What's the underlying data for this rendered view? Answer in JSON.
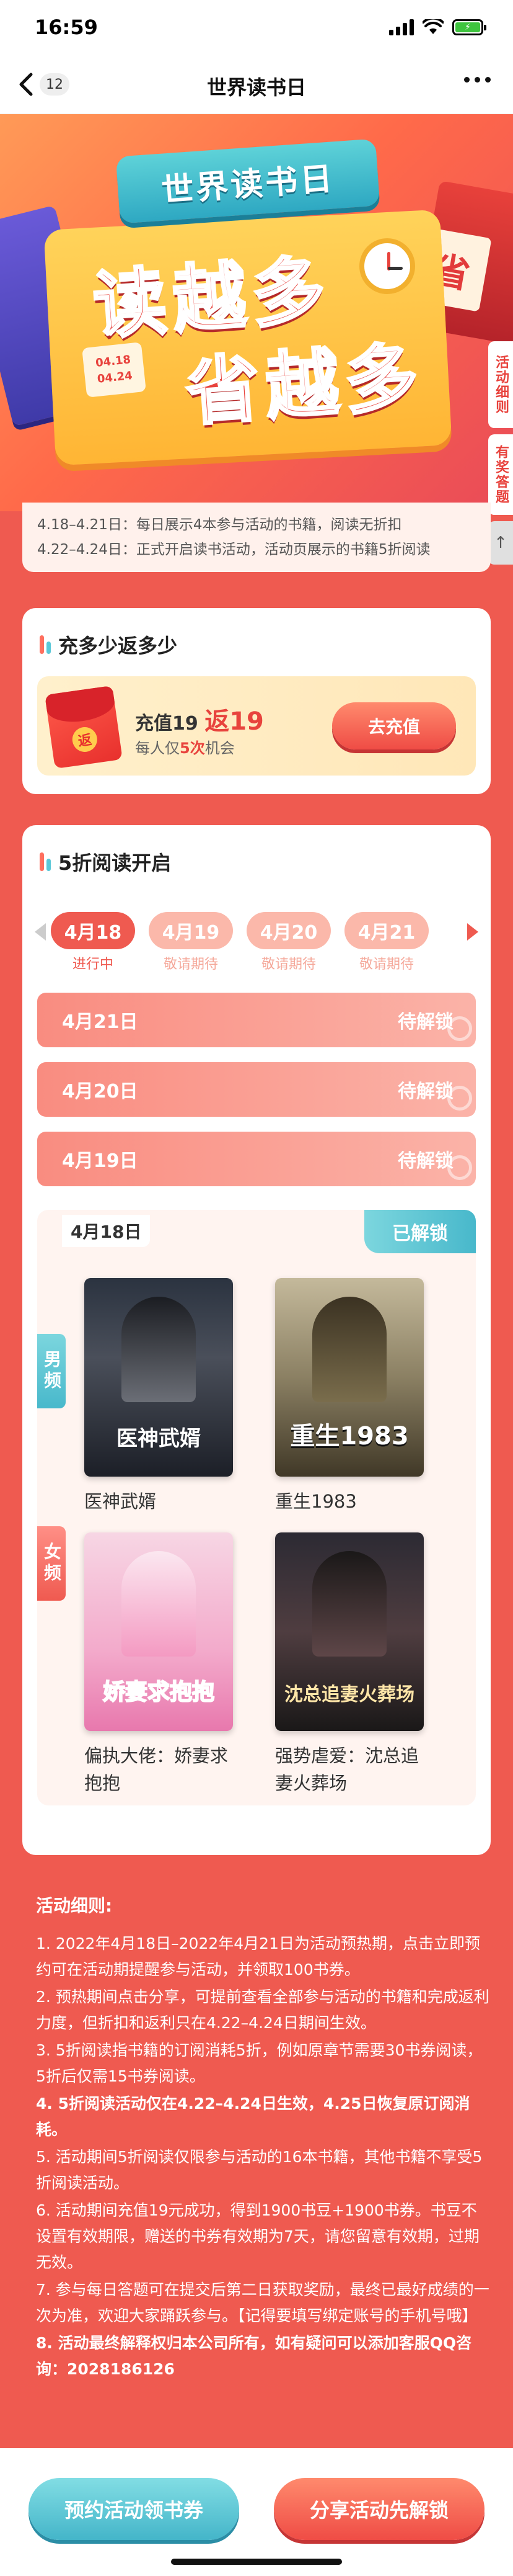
{
  "status_bar": {
    "time": "16:59",
    "battery_icon": "battery-charging-icon"
  },
  "nav": {
    "back_count": "12",
    "title": "世界读书日"
  },
  "banner": {
    "ribbon_title": "世界读书日",
    "headline_1": "读越多",
    "headline_2": "省越多",
    "date_start": "04.18",
    "date_end": "04.24",
    "side_char": "省",
    "side_tab_rules": "活动细则",
    "side_tab_qa": "有奖答题",
    "side_tab_up": "↑"
  },
  "intro": {
    "line1": "4.18–4.21日：每日展示4本参与活动的书籍，阅读无折扣",
    "line2": "4.22–4.24日：正式开启读书活动，活动页展示的书籍5折阅读"
  },
  "cashback": {
    "section_title": "充多少返多少",
    "packet_char": "返",
    "line1_prefix": "充值19",
    "line1_highlight": "返19",
    "line2_prefix": "每人仅",
    "line2_highlight": "5次",
    "line2_suffix": "机会",
    "button": "去充值"
  },
  "discount": {
    "section_title": "5折阅读开启",
    "tabs": [
      {
        "date": "4月18",
        "status": "进行中",
        "active": true
      },
      {
        "date": "4月19",
        "status": "敬请期待",
        "active": false
      },
      {
        "date": "4月20",
        "status": "敬请期待",
        "active": false
      },
      {
        "date": "4月21",
        "status": "敬请期待",
        "active": false
      }
    ],
    "locked_rows": [
      {
        "date": "4月21日",
        "status": "待解锁"
      },
      {
        "date": "4月20日",
        "status": "待解锁"
      },
      {
        "date": "4月19日",
        "status": "待解锁"
      }
    ],
    "unlocked": {
      "date": "4月18日",
      "tag": "已解锁",
      "male_label": "男频",
      "female_label": "女频",
      "books": [
        {
          "title": "医神武婿",
          "cover_text": "医神武婿"
        },
        {
          "title": "重生1983",
          "cover_text": "重生1983"
        },
        {
          "title": "偏执大佬：娇妻求抱抱",
          "cover_text": "娇妻求抱抱"
        },
        {
          "title": "强势虐爱：沈总追妻火葬场",
          "cover_text": "沈总追妻火葬场"
        }
      ]
    }
  },
  "rules": {
    "title": "活动细则:",
    "items": [
      {
        "text": "1. 2022年4月18日–2022年4月21日为活动预热期，点击立即预约可在活动期提醒参与活动，并领取100书券。",
        "bold": false
      },
      {
        "text": "2. 预热期间点击分享，可提前查看全部参与活动的书籍和完成返利力度，但折扣和返利只在4.22–4.24日期间生效。",
        "bold": false
      },
      {
        "text": "3. 5折阅读指书籍的订阅消耗5折，例如原章节需要30书券阅读，5折后仅需15书券阅读。",
        "bold": false
      },
      {
        "text": "4. 5折阅读活动仅在4.22–4.24日生效，4.25日恢复原订阅消耗。",
        "bold": true
      },
      {
        "text": "5. 活动期间5折阅读仅限参与活动的16本书籍，其他书籍不享受5折阅读活动。",
        "bold": false
      },
      {
        "text": "6. 活动期间充值19元成功，得到1900书豆+1900书券。书豆不设置有效期限，赠送的书券有效期为7天，请您留意有效期，过期无效。",
        "bold": false
      },
      {
        "text": "7. 参与每日答题可在提交后第二日获取奖励，最终已最好成绩的一次为准，欢迎大家踊跃参与。【记得要填写绑定账号的手机号哦】",
        "bold": false
      },
      {
        "text": "8. 活动最终解释权归本公司所有，如有疑问可以添加客服QQ咨询：2028186126",
        "bold": true
      }
    ]
  },
  "bottom": {
    "left_button": "预约活动领书券",
    "right_button": "分享活动先解锁"
  }
}
